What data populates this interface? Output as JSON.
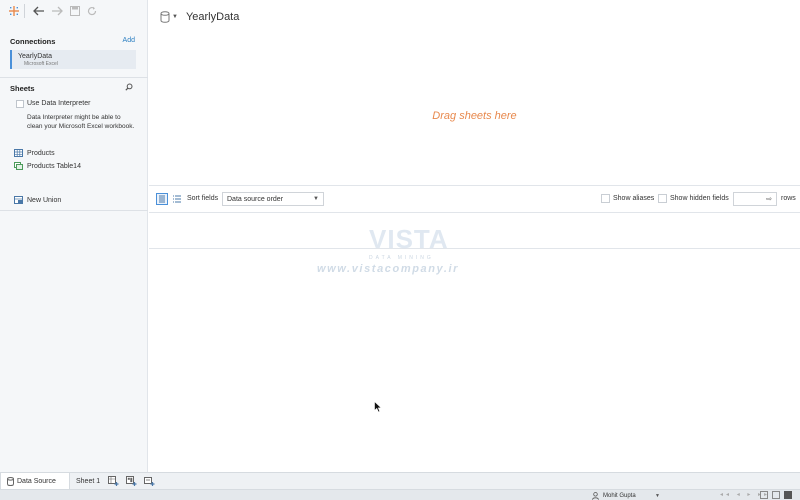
{
  "toolbar": {
    "icons": [
      "tableau-logo-icon",
      "back-icon",
      "forward-icon",
      "save-icon",
      "refresh-icon"
    ]
  },
  "connections": {
    "title": "Connections",
    "add_label": "Add",
    "items": [
      {
        "name": "YearlyData",
        "type": "Microsoft Excel"
      }
    ]
  },
  "sheets": {
    "title": "Sheets",
    "use_interpreter_label": "Use Data Interpreter",
    "interpreter_hint": "Data Interpreter might be able to clean your Microsoft Excel workbook.",
    "items": [
      {
        "label": "Products"
      },
      {
        "label": "Products Table14"
      }
    ],
    "new_union_label": "New Union"
  },
  "canvas": {
    "datasource_title": "YearlyData",
    "drag_hint": "Drag sheets here"
  },
  "grid_toolbar": {
    "sort_label": "Sort fields",
    "sort_value": "Data source order",
    "show_aliases_label": "Show aliases",
    "show_hidden_label": "Show hidden fields",
    "rows_label": "rows"
  },
  "watermark": {
    "logo_text": "VISTA",
    "sub_text": "DATA MINING",
    "url_text": "www.vistacompany.ir"
  },
  "tabs": {
    "datasource_label": "Data Source",
    "sheet1_label": "Sheet 1"
  },
  "status": {
    "user_name": "Mohit Gupta"
  },
  "colors": {
    "accent": "#4a90d9",
    "drag_hint": "#e8894d",
    "link": "#2a7ec1"
  }
}
